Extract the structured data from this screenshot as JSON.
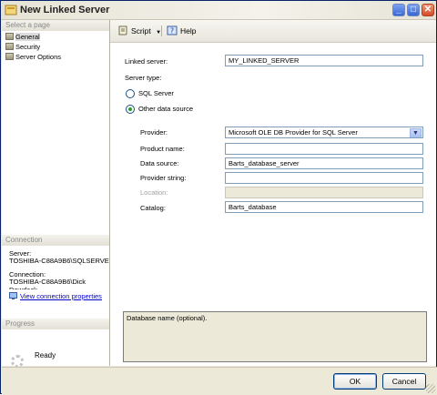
{
  "window": {
    "title": "New Linked Server"
  },
  "left_panel": {
    "select_page_header": "Select a page",
    "pages": [
      {
        "label": "General",
        "selected": true
      },
      {
        "label": "Security",
        "selected": false
      },
      {
        "label": "Server Options",
        "selected": false
      }
    ],
    "connection_header": "Connection",
    "server_label": "Server:",
    "server_value": "TOSHIBA-C88A9B6\\SQLSERVEI",
    "connection_label": "Connection:",
    "connection_value": "TOSHIBA-C88A9B6\\Dick",
    "connection_value_overflow": "Dowdeck",
    "view_connection_link": "View connection properties",
    "progress_header": "Progress",
    "progress_status": "Ready"
  },
  "toolbar": {
    "script_label": "Script",
    "help_label": "Help"
  },
  "form": {
    "linked_server_label": "Linked server:",
    "linked_server_value": "MY_LINKED_SERVER",
    "server_type_label": "Server type:",
    "sql_server_option": "SQL Server",
    "other_source_option": "Other data source",
    "selected_server_type": "Other data source",
    "provider_label": "Provider:",
    "provider_value": "Microsoft OLE DB Provider for SQL Server",
    "product_name_label": "Product name:",
    "product_name_value": "",
    "data_source_label": "Data source:",
    "data_source_value": "Barts_database_server",
    "provider_string_label": "Provider string:",
    "provider_string_value": "",
    "location_label": "Location:",
    "location_value": "",
    "catalog_label": "Catalog:",
    "catalog_value": "Barts_database"
  },
  "help_text": "Database name (optional).",
  "buttons": {
    "ok": "OK",
    "cancel": "Cancel"
  },
  "colors": {
    "accent": "#21a121",
    "link": "#0000cc",
    "chrome": "#ece9d8"
  }
}
